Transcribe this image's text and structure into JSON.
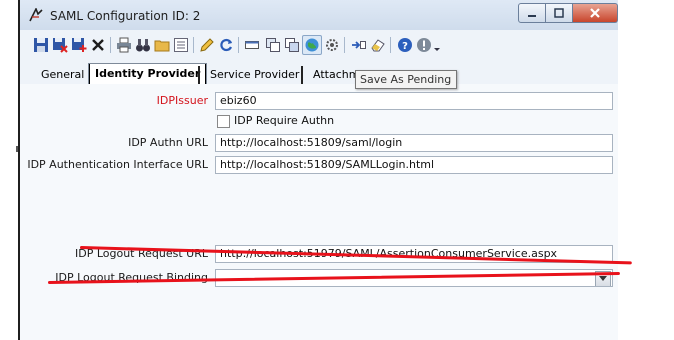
{
  "window": {
    "title": "SAML Configuration ID: 2"
  },
  "tabs": [
    {
      "label": "General"
    },
    {
      "label": "Identity Provider"
    },
    {
      "label": "Service Provider"
    },
    {
      "label": "Attachm"
    }
  ],
  "tooltip": {
    "text": "Save As Pending"
  },
  "form": {
    "idp_issuer": {
      "label": "IDPIssuer",
      "value": "ebiz60"
    },
    "require_authn": {
      "label": "IDP Require Authn",
      "checked": false
    },
    "authn_url": {
      "label": "IDP Authn URL",
      "value": "http://localhost:51809/saml/login"
    },
    "auth_interface_url": {
      "label": "IDP Authentication Interface URL",
      "value": "http://localhost:51809/SAMLLogin.html"
    },
    "logout_request_url": {
      "label": "IDP Logout Request URL",
      "value": "http://localhost:51979/SAML/AssertionConsumerService.aspx"
    },
    "logout_request_binding": {
      "label": "IDP Logout Request Binding",
      "value": ""
    }
  },
  "colors": {
    "required_label": "#d4141c",
    "annotation_strike": "#e8121b"
  }
}
